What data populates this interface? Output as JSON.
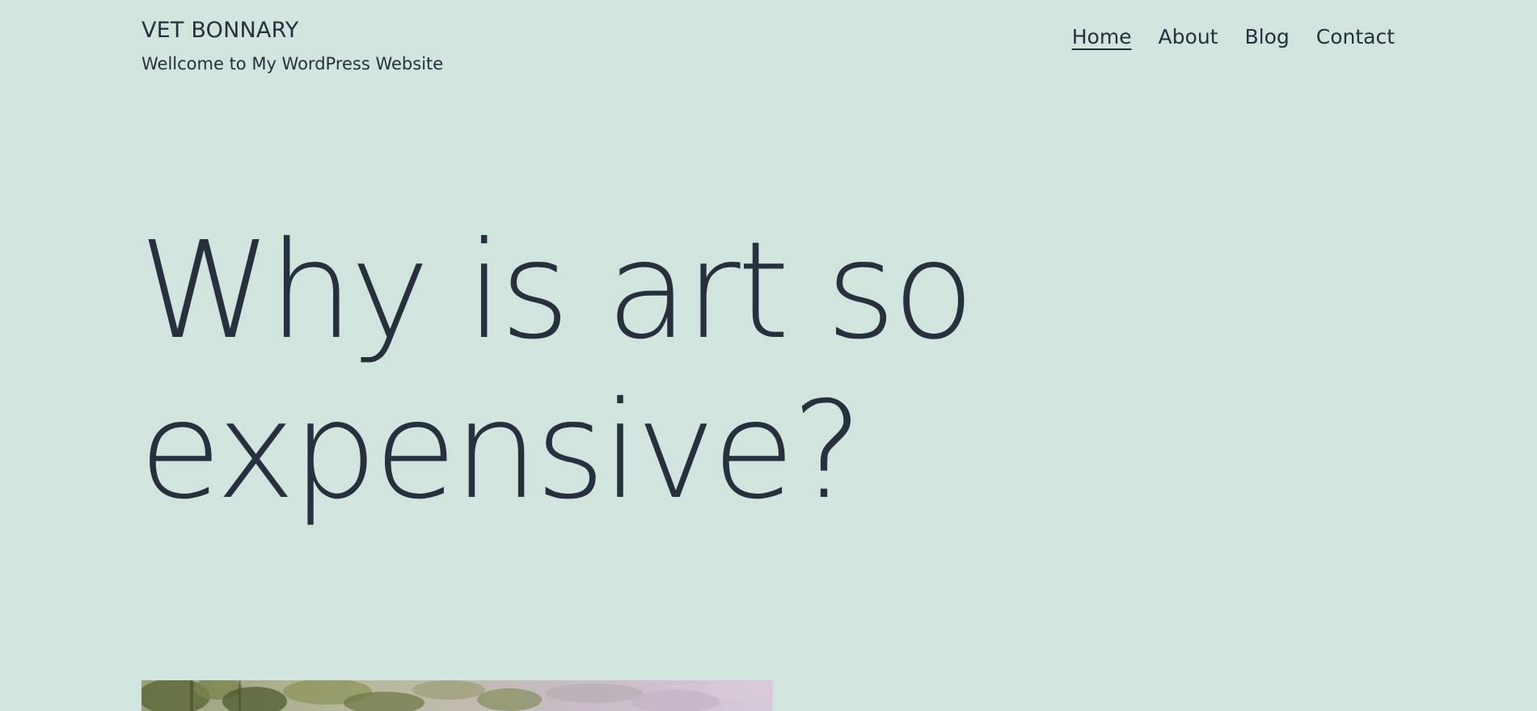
{
  "header": {
    "site_title": "VET BONNARY",
    "tagline": "Wellcome to My WordPress Website"
  },
  "nav": {
    "items": [
      {
        "label": "Home",
        "current": true
      },
      {
        "label": "About",
        "current": false
      },
      {
        "label": "Blog",
        "current": false
      },
      {
        "label": "Contact",
        "current": false
      }
    ]
  },
  "post": {
    "title": "Why is art so expensive?"
  },
  "colors": {
    "background": "#d1e4dd",
    "text": "#28303d"
  }
}
